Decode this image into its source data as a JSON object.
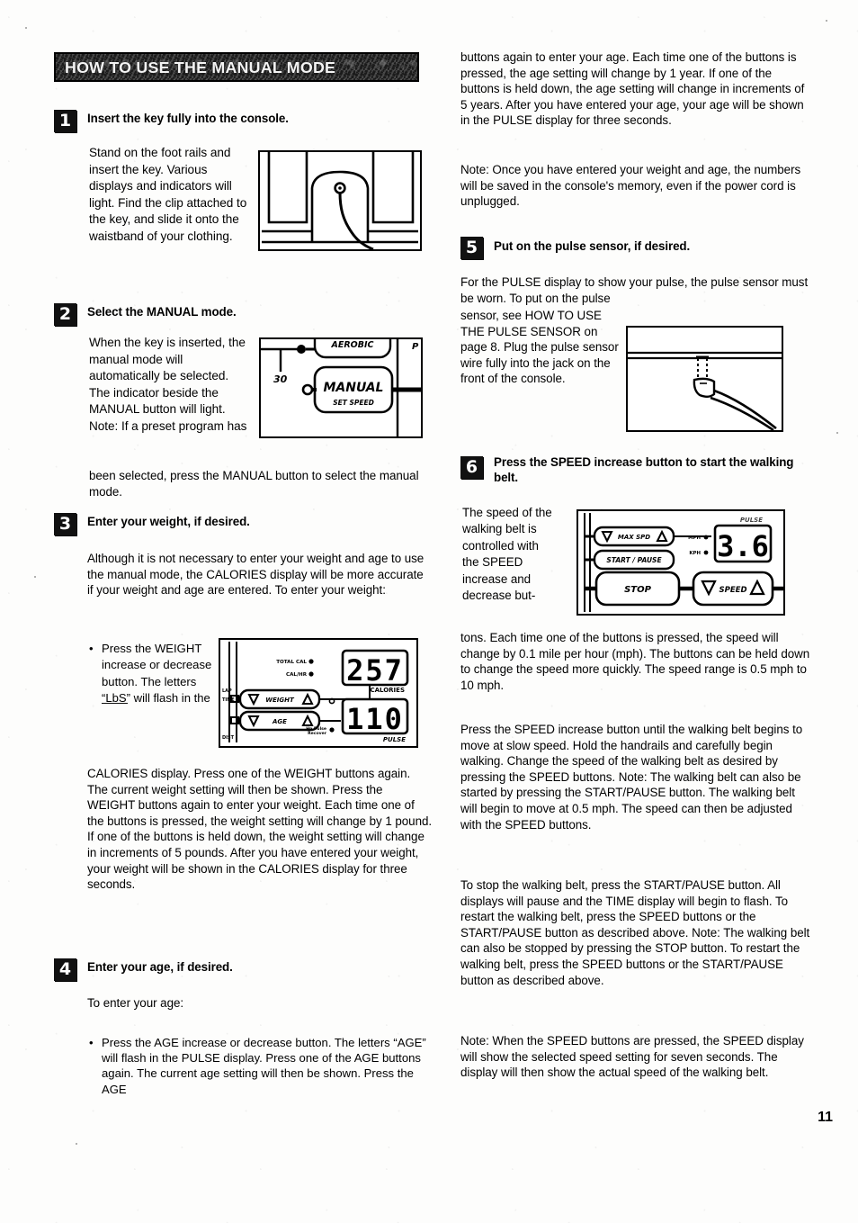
{
  "document": {
    "page_number": "11",
    "banner_title": "HOW TO USE THE MANUAL MODE"
  },
  "steps": [
    {
      "number": "1",
      "heading": "Insert the key fully into the console.",
      "body": "Stand on the foot rails and insert the key. Various displays and indicators will light. Find the clip attached to the key, and slide it onto the waistband of your clothing."
    },
    {
      "number": "2",
      "heading": "Select the MANUAL mode.",
      "body_narrow": "When the key is inserted, the manual mode will automatically be selected. The indicator beside the MANUAL button will light. Note: If a preset program has",
      "body_wide": "been selected, press the MANUAL button to select the manual mode."
    },
    {
      "number": "3",
      "heading": "Enter your weight, if desired.",
      "intro": "Although it is not necessary to enter your weight and age to use the manual mode, the CALORIES display will be more accurate if your weight and age are entered. To enter your weight:",
      "bullet_narrow_a": "Press the",
      "bullet_narrow_b": "WEIGHT increase or decrease button. The letters",
      "bullet_quoted": "“LbS”",
      "bullet_narrow_c": "will flash in the",
      "bullet_wide": "CALORIES display. Press one of the WEIGHT buttons again. The current weight setting will then be shown. Press the WEIGHT buttons again to enter your weight. Each time one of the buttons is pressed, the weight setting will change by 1 pound. If one of the buttons is held down, the weight setting will change in increments of 5 pounds. After you have entered your weight, your weight will be shown in the CALORIES display for three seconds."
    },
    {
      "number": "4",
      "heading": "Enter your age, if desired.",
      "intro": "To enter your age:",
      "bullet": "Press the AGE increase or decrease button. The letters “AGE” will flash in the PULSE display. Press one of the AGE buttons again. The current age setting will then be shown. Press the AGE"
    },
    {
      "number": "5",
      "heading": "Put on the pulse sensor, if desired.",
      "body_wide": "For the PULSE display to show your pulse, the pulse sensor must be worn. To put on the pulse",
      "body_narrow": "sensor, see HOW TO USE THE PULSE SENSOR on page 8. Plug the pulse sensor wire fully into the jack on the front of the console."
    },
    {
      "number": "6",
      "heading": "Press the SPEED increase button to start the walking belt.",
      "body_narrow": "The speed of the walking belt is controlled with the SPEED increase and decrease but-",
      "body_wide": "tons. Each time one of the buttons is pressed, the speed will change by 0.1 mile per hour (mph). The buttons can be held down to change the speed more quickly. The speed range is 0.5 mph to 10 mph."
    }
  ],
  "right_column": {
    "continued_paragraph": "buttons again to enter your age. Each time one of the buttons is pressed, the age setting will change by 1 year. If one of the buttons is held down, the age setting will change in increments of 5 years. After you have entered your age, your age will be shown in the PULSE display for three seconds.",
    "note_memory": "Note: Once you have entered your weight and age, the numbers will be saved in the console's memory, even if the power cord is unplugged.",
    "para_start_belt": "Press the SPEED increase button until the walking belt begins to move at slow speed. Hold the handrails and carefully begin walking. Change the speed of the walking belt as desired by pressing the SPEED buttons. Note: The walking belt can also be started by pressing the START/PAUSE button. The walking belt will begin to move at 0.5 mph. The speed can then be adjusted with the SPEED buttons.",
    "para_stop_belt": "To stop the walking belt, press the START/PAUSE button. All displays will pause and the TIME display will begin to flash. To restart the walking belt, press the SPEED buttons or the START/PAUSE button as described above. Note: The walking belt can also be stopped by pressing the STOP button. To restart the walking belt, press the SPEED buttons or the START/PAUSE button as described above.",
    "note_speed_display": "Note: When the SPEED buttons are pressed, the SPEED display will show the selected speed setting for seven seconds. The display will then show the actual speed of the walking belt."
  },
  "figures": {
    "key_console": {
      "caption_labels": []
    },
    "mode_panel": {
      "labels": [
        "AEROBIC",
        "MANUAL",
        "SET SPEED",
        "30",
        "P"
      ]
    },
    "weight_age_panel": {
      "buttons": [
        "WEIGHT",
        "AGE"
      ],
      "indicators": [
        "TOTAL CAL",
        "CAL/HR",
        "Hp Pulse",
        "Recover"
      ],
      "calories_value": "257",
      "calories_label": "CALORIES",
      "pulse_value": "110",
      "pulse_label": "PULSE"
    },
    "pulse_jack": {
      "labels": []
    },
    "speed_panel": {
      "buttons": [
        "MAX SPD",
        "START / PAUSE",
        "STOP",
        "SPEED"
      ],
      "indicators": [
        "MPH",
        "KPH"
      ],
      "top_label": "PULSE",
      "speed_value": "3.6"
    }
  },
  "colors": {
    "ink": "#000000",
    "paper": "#fdfdfc",
    "banner_bg": "#1b1b1b",
    "banner_text": "#f3f3f3"
  }
}
